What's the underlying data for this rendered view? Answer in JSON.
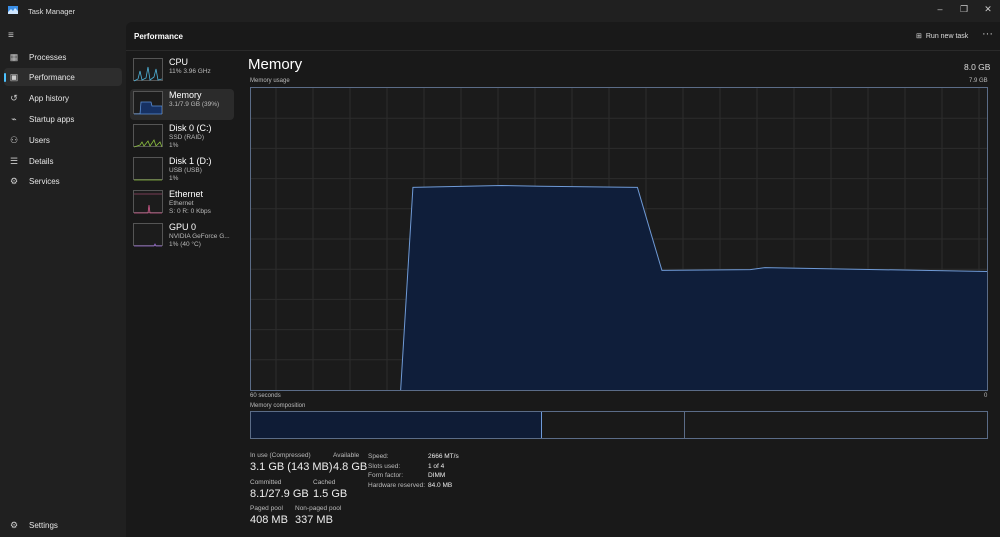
{
  "window": {
    "title": "Task Manager"
  },
  "nav": {
    "items": [
      {
        "label": "Processes",
        "icon": "processes-icon"
      },
      {
        "label": "Performance",
        "icon": "performance-icon",
        "active": true
      },
      {
        "label": "App history",
        "icon": "history-icon"
      },
      {
        "label": "Startup apps",
        "icon": "startup-icon"
      },
      {
        "label": "Users",
        "icon": "users-icon"
      },
      {
        "label": "Details",
        "icon": "details-icon"
      },
      {
        "label": "Services",
        "icon": "services-icon"
      }
    ],
    "settings": "Settings"
  },
  "header": {
    "title": "Performance",
    "run_new_task": "Run new task"
  },
  "resources": [
    {
      "name": "CPU",
      "line1": "11% 3.96 GHz",
      "line2": "",
      "color": "#4fb3d9"
    },
    {
      "name": "Memory",
      "line1": "3.1/7.9 GB (39%)",
      "line2": "",
      "color": "#5a8fd6"
    },
    {
      "name": "Disk 0 (C:)",
      "line1": "SSD (RAID)",
      "line2": "1%",
      "color": "#8cbf3f"
    },
    {
      "name": "Disk 1 (D:)",
      "line1": "USB (USB)",
      "line2": "1%",
      "color": "#8cbf3f"
    },
    {
      "name": "Ethernet",
      "line1": "Ethernet",
      "line2": "S: 0 R: 0 Kbps",
      "color": "#d25a8c"
    },
    {
      "name": "GPU 0",
      "line1": "NVIDIA GeForce G...",
      "line2": "1% (40 °C)",
      "color": "#9a6bd6"
    }
  ],
  "memory": {
    "title": "Memory",
    "total": "8.0 GB",
    "usage_label": "Memory usage",
    "max_label": "7.9 GB",
    "x_left": "60 seconds",
    "x_right": "0",
    "composition_label": "Memory composition",
    "composition": {
      "in_use_pct": 39.6,
      "standby_pct": 19.4,
      "free_pct": 41.0
    },
    "stats": {
      "in_use_label": "In use (Compressed)",
      "in_use": "3.1 GB (143 MB)",
      "available_label": "Available",
      "available": "4.8 GB",
      "committed_label": "Committed",
      "committed": "8.1/27.9 GB",
      "cached_label": "Cached",
      "cached": "1.5 GB",
      "paged_label": "Paged pool",
      "paged": "408 MB",
      "nonpaged_label": "Non-paged pool",
      "nonpaged": "337 MB"
    },
    "specs": [
      {
        "k": "Speed:",
        "v": "2666 MT/s"
      },
      {
        "k": "Slots used:",
        "v": "1 of 4"
      },
      {
        "k": "Form factor:",
        "v": "DIMM"
      },
      {
        "k": "Hardware reserved:",
        "v": "84.0 MB"
      }
    ]
  },
  "chart_data": {
    "type": "area",
    "xlabel": "",
    "ylabel": "",
    "x_unit": "seconds ago",
    "xlim": [
      60,
      0
    ],
    "ylim": [
      0,
      7.9
    ],
    "grid": true,
    "points": [
      [
        47.8,
        0
      ],
      [
        46.8,
        5.3
      ],
      [
        39.6,
        5.35
      ],
      [
        36.4,
        5.33
      ],
      [
        28.5,
        5.3
      ],
      [
        27.4,
        4.1
      ],
      [
        26.5,
        3.13
      ],
      [
        19.3,
        3.15
      ],
      [
        18.1,
        3.2
      ],
      [
        0,
        3.1
      ]
    ],
    "line_color": "#6f9ad6",
    "fill_color": "#0f1e3a"
  }
}
